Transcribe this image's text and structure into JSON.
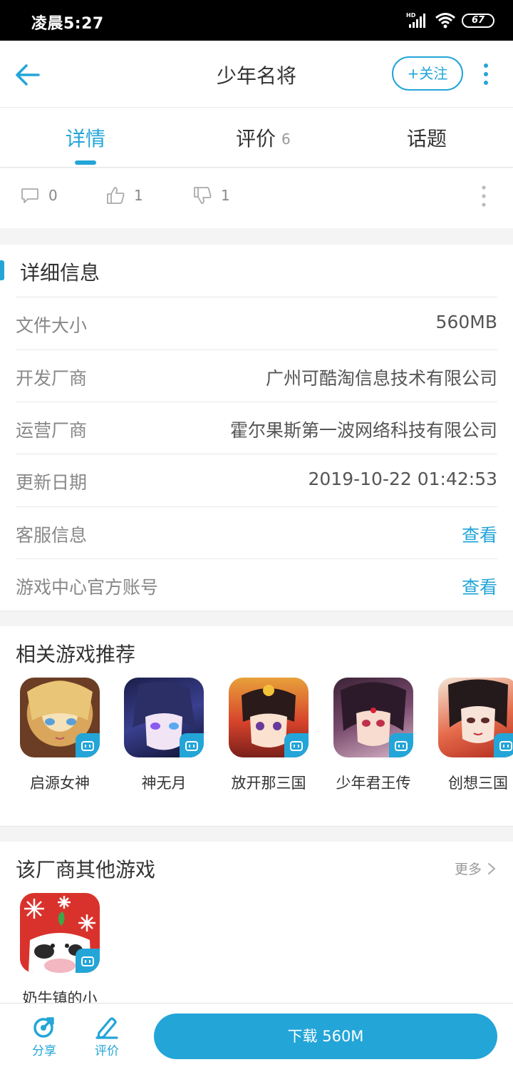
{
  "status_bar": {
    "time": "凌晨5:27",
    "battery": "67"
  },
  "app_bar": {
    "title": "少年名将",
    "follow_label": "+关注"
  },
  "tabs": [
    {
      "label": "详情"
    },
    {
      "label": "评价",
      "count": "6"
    },
    {
      "label": "话题"
    }
  ],
  "reactions": {
    "comments": "0",
    "likes": "1",
    "dislikes": "1"
  },
  "details": {
    "title": "详细信息",
    "rows": [
      {
        "label": "文件大小",
        "value": "560MB"
      },
      {
        "label": "开发厂商",
        "value": "广州可酷淘信息技术有限公司"
      },
      {
        "label": "运营厂商",
        "value": "霍尔果斯第一波网络科技有限公司"
      },
      {
        "label": "更新日期",
        "value": "2019-10-22 01:42:53"
      },
      {
        "label": "客服信息",
        "value": "查看"
      },
      {
        "label": "游戏中心官方账号",
        "value": "查看"
      }
    ]
  },
  "related": {
    "title": "相关游戏推荐",
    "games": [
      {
        "name": "启源女神"
      },
      {
        "name": "神无月"
      },
      {
        "name": "放开那三国"
      },
      {
        "name": "少年君王传"
      },
      {
        "name": "创想三国"
      }
    ]
  },
  "vendor": {
    "title": "该厂商其他游戏",
    "more_label": "更多",
    "games": [
      {
        "name": "奶牛镇的小"
      }
    ]
  },
  "bottom_bar": {
    "share_label": "分享",
    "review_label": "评价",
    "download_label": "下载 560M"
  },
  "colors": {
    "accent": "#23a5d8"
  }
}
